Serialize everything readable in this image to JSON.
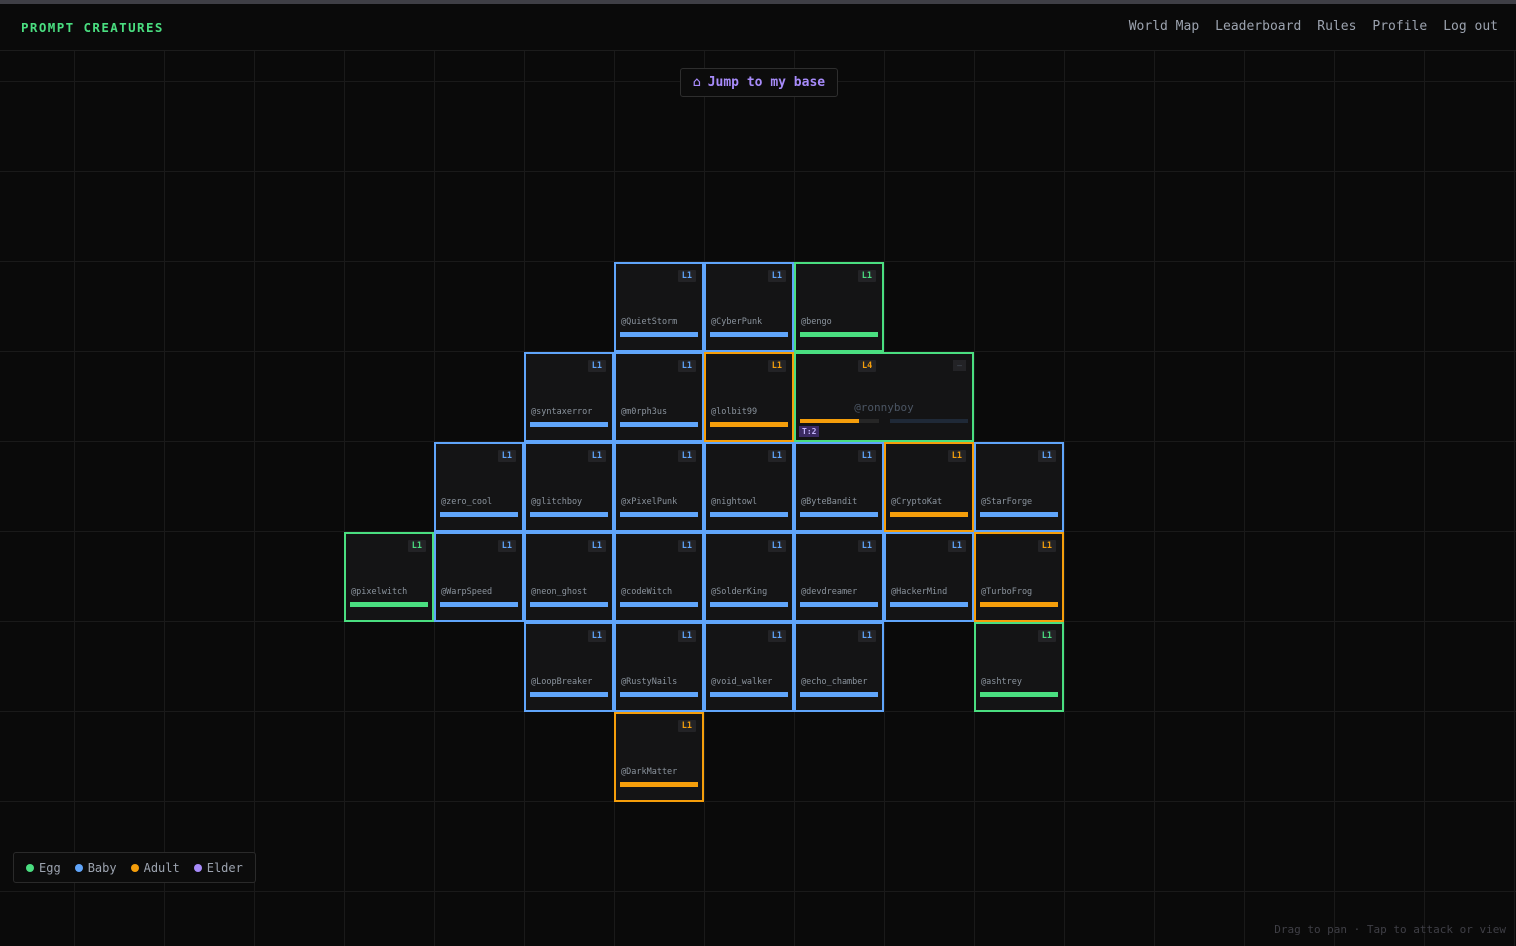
{
  "app": {
    "brand": "PROMPT CREATURES"
  },
  "nav": [
    "World Map",
    "Leaderboard",
    "Rules",
    "Profile",
    "Log out"
  ],
  "jump_button": {
    "icon": "home-icon",
    "glyph": "⌂",
    "label": "Jump to my base"
  },
  "colors": {
    "egg": "#4ade80",
    "baby": "#60a5fa",
    "adult": "#f59e0b",
    "elder": "#a78bfa"
  },
  "legend": [
    {
      "stage": "egg",
      "label": "Egg"
    },
    {
      "stage": "baby",
      "label": "Baby"
    },
    {
      "stage": "adult",
      "label": "Adult"
    },
    {
      "stage": "elder",
      "label": "Elder"
    }
  ],
  "hint": "Drag to pan · Tap to attack or view",
  "plots": [
    {
      "row": 0,
      "col": 3,
      "user": "@QuietStorm",
      "level": "L1",
      "stage": "baby"
    },
    {
      "row": 0,
      "col": 4,
      "user": "@CyberPunk",
      "level": "L1",
      "stage": "baby"
    },
    {
      "row": 0,
      "col": 5,
      "user": "@bengo",
      "level": "L1",
      "stage": "egg"
    },
    {
      "row": 1,
      "col": 2,
      "user": "@syntaxerror",
      "level": "L1",
      "stage": "baby"
    },
    {
      "row": 1,
      "col": 3,
      "user": "@m0rph3us",
      "level": "L1",
      "stage": "baby"
    },
    {
      "row": 1,
      "col": 4,
      "user": "@lolbit99",
      "level": "L1",
      "stage": "adult"
    },
    {
      "row": 2,
      "col": 1,
      "user": "@zero_cool",
      "level": "L1",
      "stage": "baby"
    },
    {
      "row": 2,
      "col": 2,
      "user": "@glitchboy",
      "level": "L1",
      "stage": "baby"
    },
    {
      "row": 2,
      "col": 3,
      "user": "@xPixelPunk",
      "level": "L1",
      "stage": "baby"
    },
    {
      "row": 2,
      "col": 4,
      "user": "@nightowl",
      "level": "L1",
      "stage": "baby"
    },
    {
      "row": 2,
      "col": 5,
      "user": "@ByteBandit",
      "level": "L1",
      "stage": "baby"
    },
    {
      "row": 2,
      "col": 6,
      "user": "@CryptoKat",
      "level": "L1",
      "stage": "adult"
    },
    {
      "row": 2,
      "col": 7,
      "user": "@StarForge",
      "level": "L1",
      "stage": "baby"
    },
    {
      "row": 3,
      "col": 0,
      "user": "@pixelwitch",
      "level": "L1",
      "stage": "egg"
    },
    {
      "row": 3,
      "col": 1,
      "user": "@WarpSpeed",
      "level": "L1",
      "stage": "baby"
    },
    {
      "row": 3,
      "col": 2,
      "user": "@neon_ghost",
      "level": "L1",
      "stage": "baby"
    },
    {
      "row": 3,
      "col": 3,
      "user": "@codeWitch",
      "level": "L1",
      "stage": "baby"
    },
    {
      "row": 3,
      "col": 4,
      "user": "@SolderKing",
      "level": "L1",
      "stage": "baby"
    },
    {
      "row": 3,
      "col": 5,
      "user": "@devdreamer",
      "level": "L1",
      "stage": "baby"
    },
    {
      "row": 3,
      "col": 6,
      "user": "@HackerMind",
      "level": "L1",
      "stage": "baby"
    },
    {
      "row": 3,
      "col": 7,
      "user": "@TurboFrog",
      "level": "L1",
      "stage": "adult"
    },
    {
      "row": 4,
      "col": 2,
      "user": "@LoopBreaker",
      "level": "L1",
      "stage": "baby"
    },
    {
      "row": 4,
      "col": 3,
      "user": "@RustyNails",
      "level": "L1",
      "stage": "baby"
    },
    {
      "row": 4,
      "col": 4,
      "user": "@void_walker",
      "level": "L1",
      "stage": "baby"
    },
    {
      "row": 4,
      "col": 5,
      "user": "@echo_chamber",
      "level": "L1",
      "stage": "baby"
    },
    {
      "row": 4,
      "col": 7,
      "user": "@ashtrey",
      "level": "L1",
      "stage": "egg"
    },
    {
      "row": 5,
      "col": 3,
      "user": "@DarkMatter",
      "level": "L1",
      "stage": "adult"
    }
  ],
  "big_plot": {
    "row": 1,
    "col": 5,
    "user": "@ronnyboy",
    "level": "L4",
    "stage": "egg",
    "level_stage": "adult",
    "badge": "T:2",
    "corner": "—",
    "hp": 0.75,
    "hp2": 0
  }
}
